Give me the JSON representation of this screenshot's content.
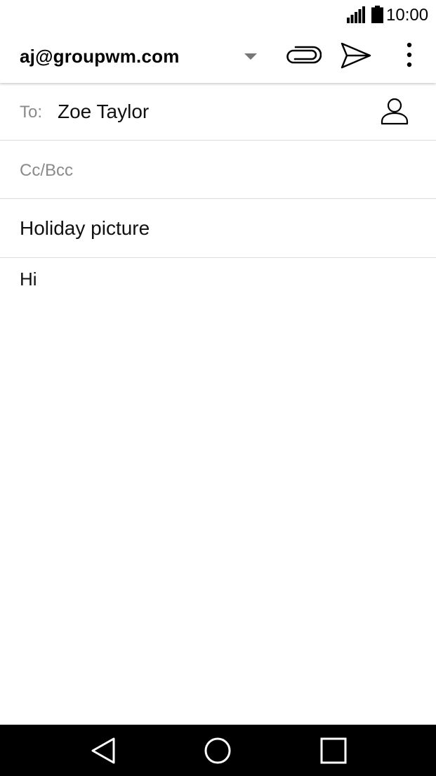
{
  "status_bar": {
    "time": "10:00",
    "icons": [
      "signal-icon",
      "battery-icon"
    ]
  },
  "app_bar": {
    "account": "aj@groupwm.com",
    "icons": [
      "dropdown-arrow-icon",
      "paperclip-icon",
      "send-icon",
      "more-vert-icon"
    ]
  },
  "compose": {
    "to_label": "To:",
    "to_value": "Zoe Taylor",
    "cc_bcc_label": "Cc/Bcc",
    "subject": "Holiday picture",
    "body": "Hi"
  },
  "nav_bar": {
    "icons": [
      "back-icon",
      "home-icon",
      "recent-apps-icon"
    ]
  },
  "colors": {
    "label_gray": "#8a8a8a",
    "divider": "#dcdcdc",
    "nav_bar_bg": "#000000"
  }
}
